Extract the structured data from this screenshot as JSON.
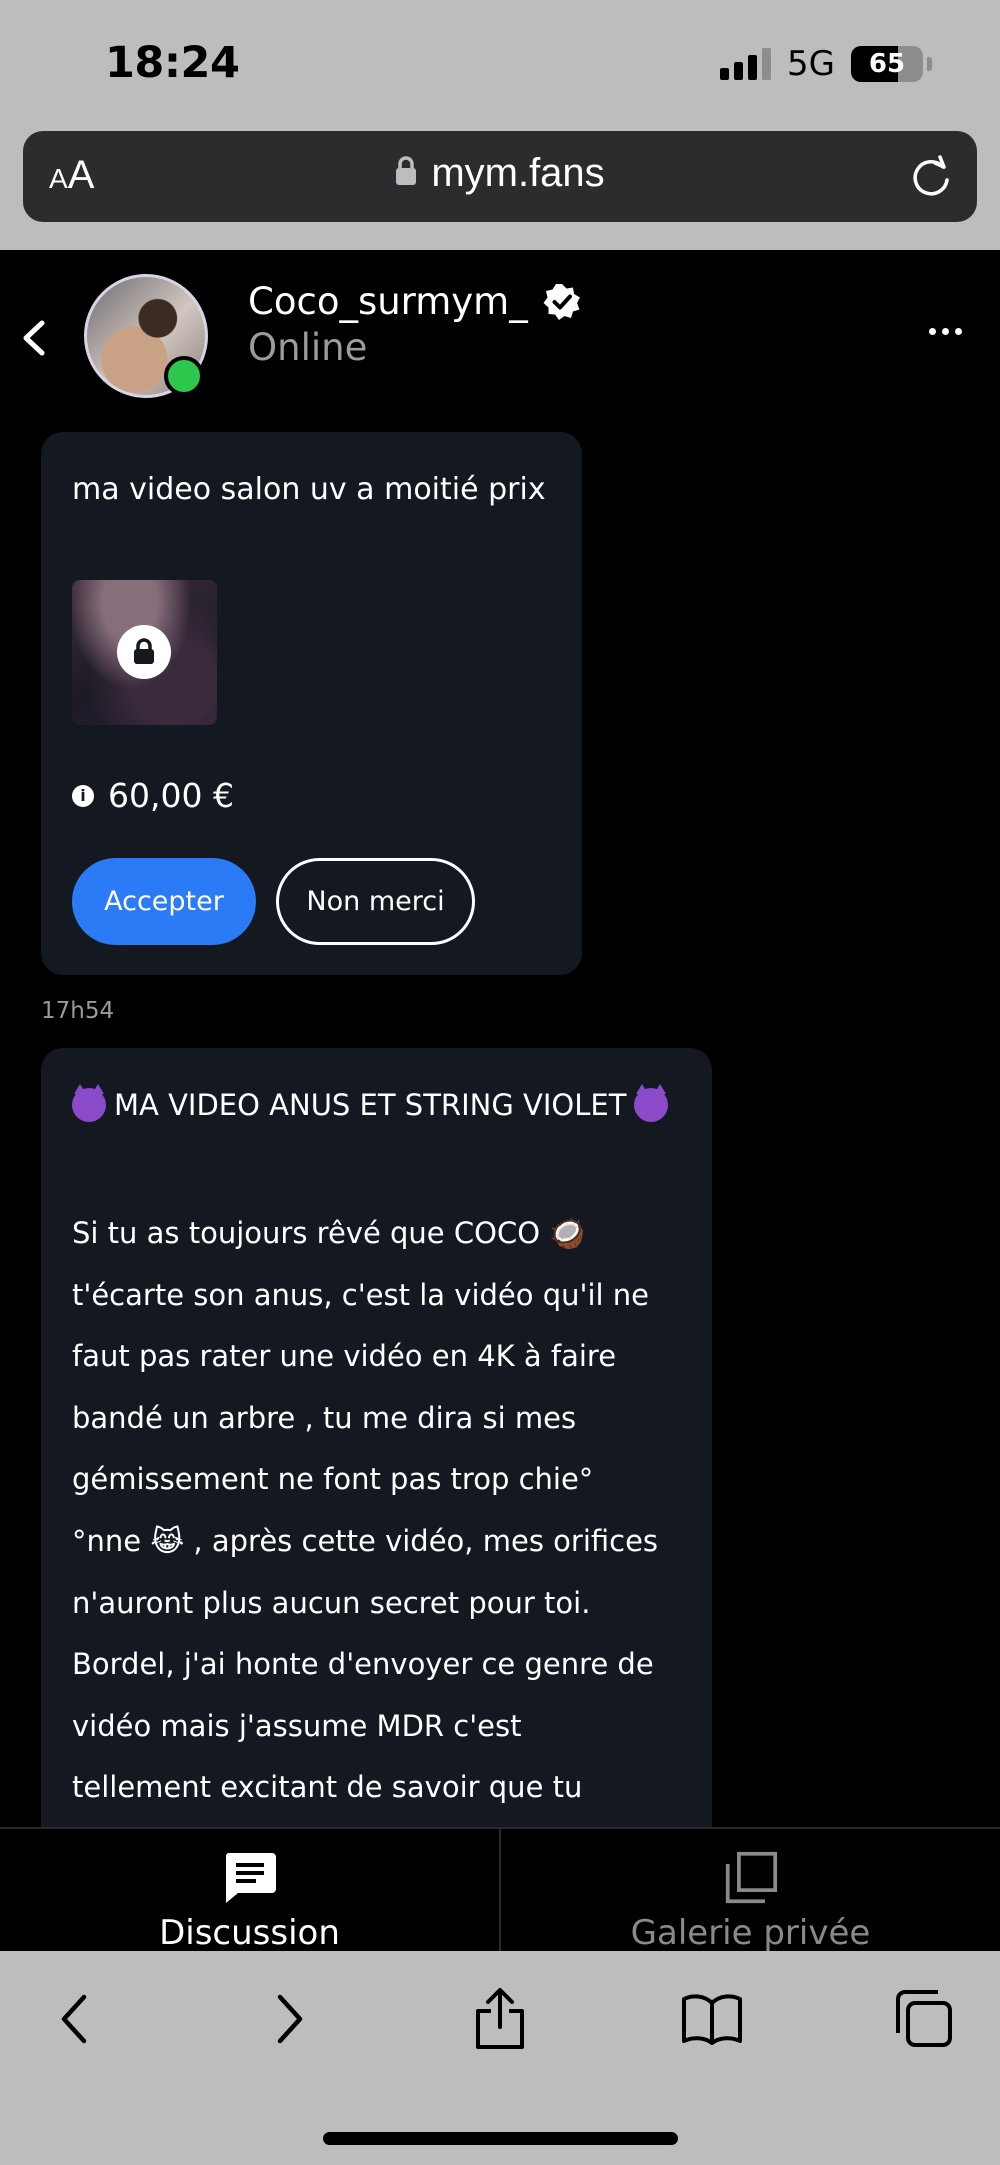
{
  "status_bar": {
    "time": "18:24",
    "network": "5G",
    "battery": "65",
    "battery_level": 0.65
  },
  "browser": {
    "aa_small": "A",
    "aa_big": "A",
    "url": "mym.fans"
  },
  "chat": {
    "username": "Coco_surmym_",
    "status": "Online"
  },
  "messages": {
    "offer": {
      "text": "ma video salon uv a moitié prix",
      "price": "60,00 €",
      "accept_label": "Accepter",
      "decline_label": "Non merci"
    },
    "timestamp": "17h54",
    "promo": {
      "title": "MA VIDEO ANUS ET STRING VIOLET",
      "body": "Si tu as toujours rêvé que COCO 🥥\nt'écarte son anus, c'est la vidéo qu'il ne\nfaut pas rater une vidéo en 4K à faire\nbandé un arbre , tu me dira si mes\ngémissement ne font pas trop chie°\n°nne 😹 , après cette vidéo, mes orifices\nn'auront plus aucun secret pour toi.\nBordel, j'ai honte d'envoyer ce genre de\nvidéo mais j'assume MDR c'est\ntellement excitant de savoir que tu"
    }
  },
  "tabs": {
    "discussion": "Discussion",
    "gallery": "Galerie privée"
  },
  "colors": {
    "accent": "#2b7bf7",
    "online": "#2cc84d",
    "bubble": "#141820"
  }
}
